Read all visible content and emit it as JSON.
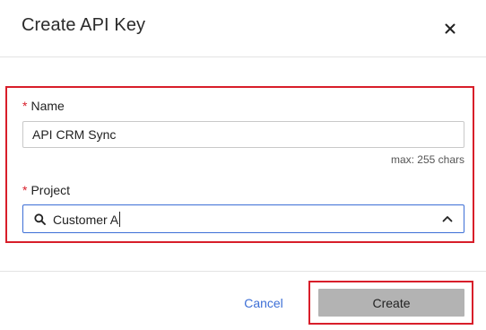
{
  "dialog": {
    "title": "Create API Key",
    "close_icon": "close-icon"
  },
  "form": {
    "required_marker": "*",
    "name": {
      "label": "Name",
      "value": "API CRM Sync",
      "hint": "max: 255 chars"
    },
    "project": {
      "label": "Project",
      "value": "Customer A",
      "search_icon": "search-icon",
      "toggle_icon": "chevron-up-icon"
    }
  },
  "footer": {
    "cancel_label": "Cancel",
    "create_label": "Create"
  },
  "colors": {
    "highlight": "#d81e2a",
    "link": "#3d6fd6",
    "focus_border": "#3d6fd6",
    "disabled_button": "#b3b3b3"
  }
}
